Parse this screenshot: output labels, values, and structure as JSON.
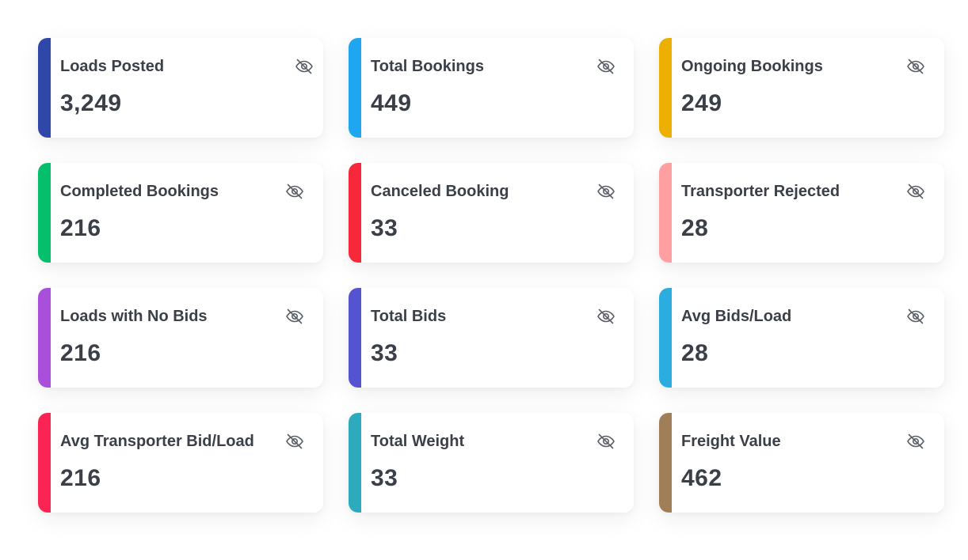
{
  "cards": [
    {
      "title": "Loads Posted",
      "value": "3,249",
      "accent": "#2f47a9",
      "icon": "eye-off-icon"
    },
    {
      "title": "Total Bookings",
      "value": "449",
      "accent": "#1ea7f0",
      "icon": "eye-off-icon"
    },
    {
      "title": "Ongoing Bookings",
      "value": "249",
      "accent": "#eeb000",
      "icon": "eye-off-icon"
    },
    {
      "title": "Completed Bookings",
      "value": "216",
      "accent": "#06bf6d",
      "icon": "eye-off-icon"
    },
    {
      "title": "Canceled Booking",
      "value": "33",
      "accent": "#f6293a",
      "icon": "eye-off-icon"
    },
    {
      "title": "Transporter Rejected",
      "value": "28",
      "accent": "#ff9fa2",
      "icon": "eye-off-icon"
    },
    {
      "title": "Loads with No Bids",
      "value": "216",
      "accent": "#a94fdc",
      "icon": "eye-off-icon"
    },
    {
      "title": "Total Bids",
      "value": "33",
      "accent": "#5553cf",
      "icon": "eye-off-icon"
    },
    {
      "title": "Avg Bids/Load",
      "value": "28",
      "accent": "#2cade0",
      "icon": "eye-off-icon"
    },
    {
      "title": "Avg Transporter Bid/Load",
      "value": "216",
      "accent": "#fb2455",
      "icon": "eye-off-icon"
    },
    {
      "title": "Total Weight",
      "value": "33",
      "accent": "#2eaabf",
      "icon": "eye-off-icon"
    },
    {
      "title": "Freight Value",
      "value": "462",
      "accent": "#a07e57",
      "icon": "eye-off-icon"
    }
  ]
}
